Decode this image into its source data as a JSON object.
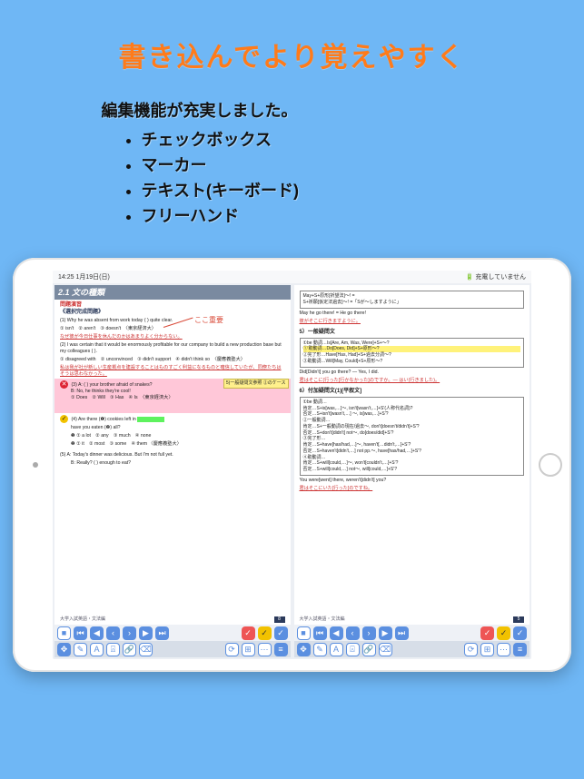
{
  "promo": {
    "headline": "書き込んでより覚えやすく",
    "subtitle": "編集機能が充実しました。",
    "features": [
      "チェックボックス",
      "マーカー",
      "テキスト(キーボード)",
      "フリーハンド"
    ]
  },
  "status": {
    "time": "14:25  1月19日(日)",
    "battery": "充電していません"
  },
  "left": {
    "title": "2.1  文の種類",
    "sub1": "問題演習",
    "sub2": "《選択完成問題》",
    "q1": "(1) Why he was absent from work today (    ) quite clear.",
    "q1opts": "① isn't　② aren't　③ doesn't　〈東京経済大〉",
    "q1ans": "なぜ彼が今日仕事を休んだのかはあまりよく分からない。",
    "q2": "(2) I was certain that it would be enormously profitable for our company to build a new production base but my colleagues (    ).",
    "q2opts": "① disagreed with　② unconvinced　③ didn't support　④ didn't think so　〈慶應義塾大〉",
    "q2ans": "私は我が社が新しい生産拠点を建設することはものすごく利益になるものと確信していたが、同僚たちはそうは思わなかった。",
    "q3": "(3) A: (    ) your brother afraid of snakes?",
    "q3b": "B: No, he thinks they're cool!",
    "q3opts": "① Does　② Will　③ Has　④ Is　〈東京経済大〉",
    "q4": "(4) Are there (❶) cookies left in",
    "q4b": "have you eaten (❷) all?",
    "q4opts1": "❶ ① a lot　② any　③ much　④ none",
    "q4opts2": "❷ ① it　② most　③ some　④ them 〈慶應義塾大〉",
    "q5a": "(5) A: Today's dinner was delicious.  But I'm not full yet.",
    "q5b": "B: Really? (    ) enough to eat?",
    "foot": "大学入試英語・文法編",
    "page": "8",
    "hand": "ここ重要",
    "sticky": "5)一般疑問文参照\n②のケース"
  },
  "right": {
    "l1": "May+S+原形[祈望法]〜!  =",
    "l2": "S+祈願[仮定法過去]〜! =「Sが〜しますように」",
    "l3": "May he go there! = He go there!",
    "l4": "彼がそこに行きますように。",
    "h5": "5）一般疑問文",
    "b1": "①be 動詞…Is[Are, Am, Was, Were]+S+〜?",
    "b2": "①'助動詞…Do[Does, Did]+S+原形〜?",
    "b3": "②完了形…Have[Has, Had]+S+過去分詞〜?",
    "b4": "③助動詞…Will[May, Could]+S+原形〜?",
    "r1": "Did[Didn't] you go there? — Yes, I did.",
    "r2": "君はそこに(行った[行かなかった]のですか。— はい(行きました)。",
    "h6": "6）付加疑問文(1)[平叙文]",
    "bx1": "①be 動詞…",
    "bx2": "肯定…S+is[was,…]〜, isn't[wasn't,…]+S'(人称代名詞)?",
    "bx3": "否定…S+isn't[wasn't,…] 〜, is[was,…]+S'?",
    "bx4": "②一般動詞…",
    "bx5": "肯定…S+一般動詞の現在/過去〜, don't[doesn't/didn't]+S'?",
    "bx6": "否定…S+don't[didn't] not〜, do[does/did]+S'?",
    "bx7": "③完了形…",
    "bx8": "肯定…S+have[has/had,…]〜, haven't[…didn't,…]+S'?",
    "bx9": "否定…S+haven't[didn't,…] not pp.〜, have[has/had,…]+S'?",
    "bx10": "④助動詞…",
    "bx11": "肯定…S+will[could,…]〜, won't[couldn't,…]+S'?",
    "bx12": "否定…S+will[could,…] not〜, will[could,…]+S'?",
    "r3": "You were[went] there, weren't[didn't] you?",
    "r4": "君はそこにいた[行った]のですね。",
    "foot": "大学入試英語・文法編",
    "page": "5"
  },
  "icons": {
    "square": "■",
    "first": "⏮",
    "prev": "◀",
    "left": "‹",
    "right": "›",
    "next": "▶",
    "last": "⏭",
    "check": "✓",
    "refresh": "⟳",
    "grid": "⊞",
    "dots": "⋯",
    "menu": "≡",
    "move": "✥",
    "pen": "✎",
    "text": "A",
    "tag": "⍓",
    "link": "🔗",
    "erase": "⌫"
  }
}
